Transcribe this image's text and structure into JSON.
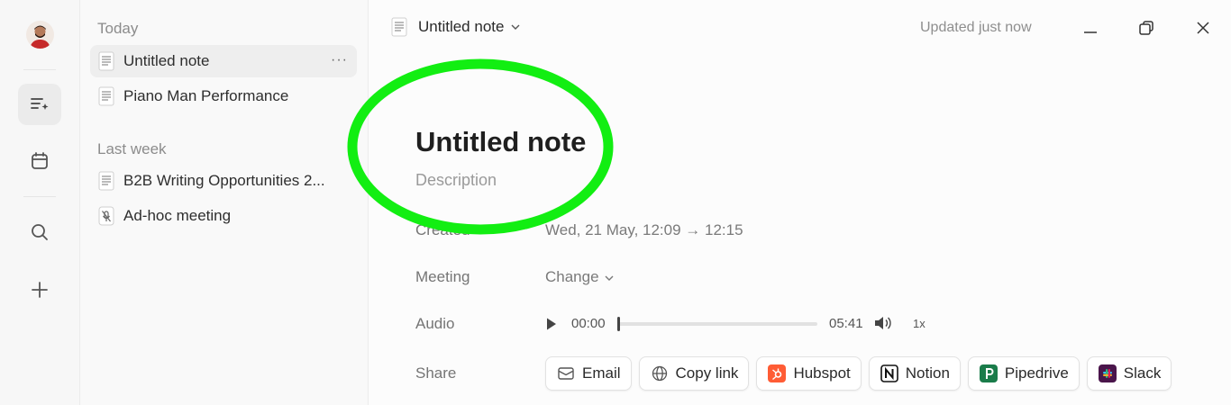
{
  "sidebar": {
    "sections": [
      {
        "label": "Today"
      },
      {
        "label": "Last week"
      }
    ],
    "notes_today": [
      {
        "label": "Untitled note",
        "active": true
      },
      {
        "label": "Piano Man Performance",
        "active": false
      }
    ],
    "notes_last_week": [
      {
        "label": "B2B Writing Opportunities 2..."
      },
      {
        "label": "Ad-hoc meeting"
      }
    ],
    "more_label": "···"
  },
  "header": {
    "title": "Untitled note",
    "status": "Updated just now"
  },
  "note": {
    "title": "Untitled note",
    "description_placeholder": "Description",
    "created_label": "Created",
    "created_value": "Wed, 21 May, 12:09 → 12:15",
    "meeting_label": "Meeting",
    "meeting_value": "Change",
    "audio_label": "Audio",
    "audio": {
      "current": "00:00",
      "total": "05:41",
      "speed": "1x",
      "progress": 0
    },
    "share_label": "Share",
    "share_buttons": [
      {
        "label": "Email",
        "icon": "mail-icon"
      },
      {
        "label": "Copy link",
        "icon": "globe-icon"
      },
      {
        "label": "Hubspot",
        "icon": "hubspot-icon",
        "color": "#ff5c35"
      },
      {
        "label": "Notion",
        "icon": "notion-icon",
        "color": "#000000"
      },
      {
        "label": "Pipedrive",
        "icon": "pipedrive-icon",
        "color": "#1a7c4a"
      },
      {
        "label": "Slack",
        "icon": "slack-icon",
        "color": "#4a154b"
      }
    ]
  },
  "colors": {
    "highlight": "#12ee12",
    "active_item": "#eeeeee"
  }
}
